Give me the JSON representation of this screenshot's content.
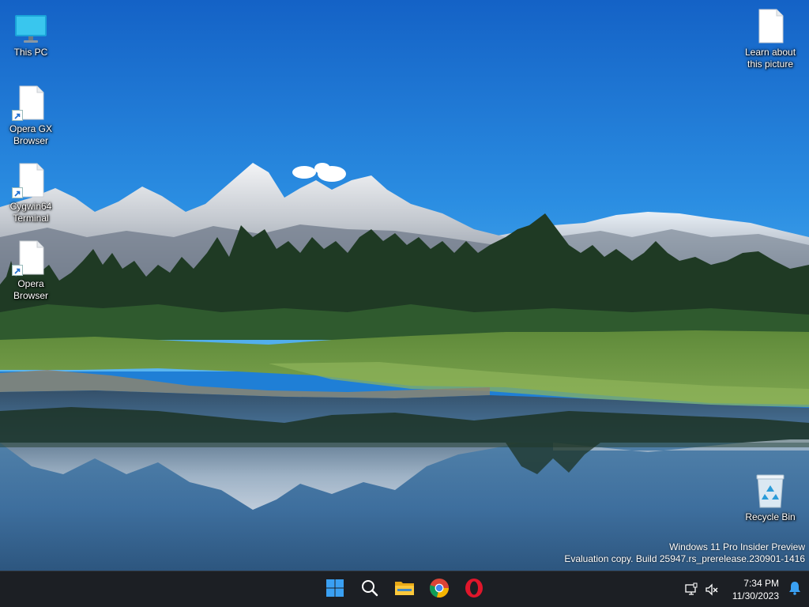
{
  "desktop": {
    "icons_left": [
      {
        "id": "this-pc",
        "label": "This PC",
        "icon": "monitor-icon"
      },
      {
        "id": "opera-gx-browser",
        "label": "Opera GX\nBrowser",
        "icon": "file-shortcut-icon"
      },
      {
        "id": "cygwin64-terminal",
        "label": "Cygwin64\nTerminal",
        "icon": "file-shortcut-icon"
      },
      {
        "id": "opera-browser",
        "label": "Opera\nBrowser",
        "icon": "file-shortcut-icon"
      }
    ],
    "learn_about": {
      "label": "Learn about\nthis picture",
      "icon": "file-icon"
    },
    "recycle_bin": {
      "label": "Recycle Bin",
      "icon": "recycle-bin-icon"
    }
  },
  "watermark": {
    "line1": "Windows 11 Pro Insider Preview",
    "line2": "Evaluation copy. Build 25947.rs_prerelease.230901-1416"
  },
  "taskbar": {
    "pinned": [
      {
        "name": "start-button",
        "icon": "windows-logo-icon"
      },
      {
        "name": "search-button",
        "icon": "search-icon"
      },
      {
        "name": "file-explorer-button",
        "icon": "folder-icon"
      },
      {
        "name": "chrome-button",
        "icon": "chrome-icon"
      },
      {
        "name": "opera-button",
        "icon": "opera-icon"
      }
    ],
    "tray": {
      "icons": [
        "network-icon",
        "volume-muted-icon"
      ],
      "time": "7:34 PM",
      "date": "11/30/2023",
      "notification_icon": "bell-icon"
    }
  },
  "colors": {
    "taskbar_bg": "#1c1f24",
    "accent_blue": "#0078d4",
    "sky_top": "#1565c8",
    "sky_bottom": "#4fb0ee"
  }
}
